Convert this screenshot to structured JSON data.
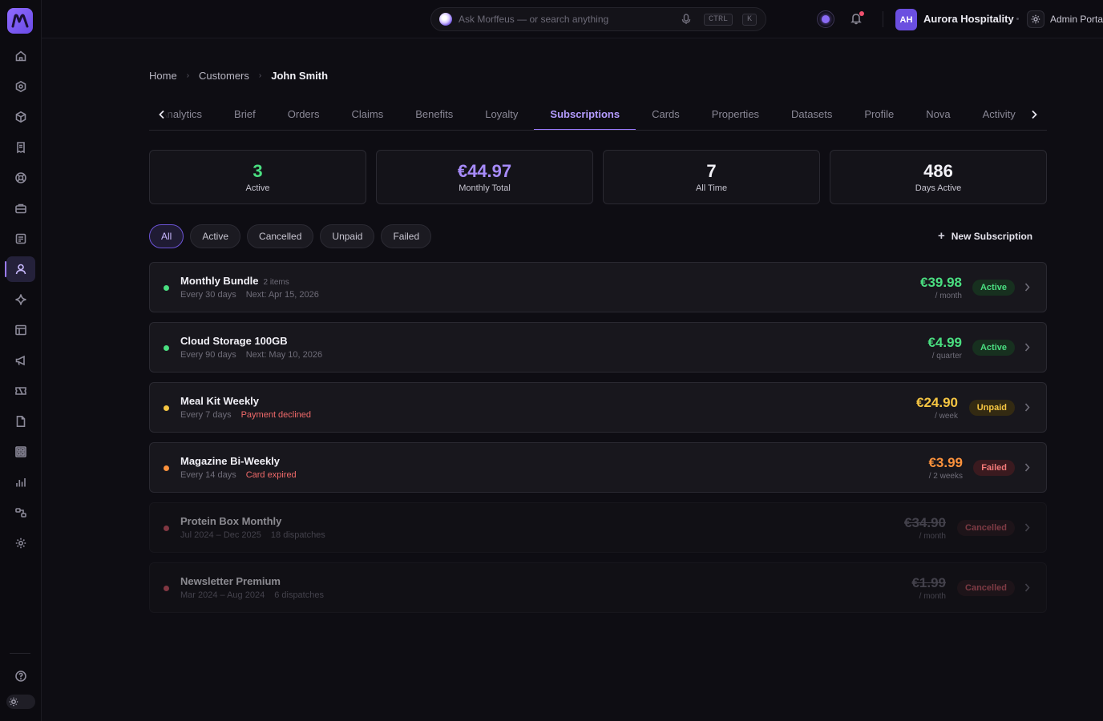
{
  "colors": {
    "accent": "#9b7bff",
    "success": "#4ade80",
    "warning": "#f5c542",
    "danger": "#f47a7a",
    "orange": "#fb923c"
  },
  "search": {
    "placeholder": "Ask Morffeus — or search anything",
    "shortcut_1": "CTRL",
    "shortcut_2": "K"
  },
  "account": {
    "initials": "AH",
    "org_name": "Aurora Hospitality",
    "portal_label": "Admin Portal"
  },
  "breadcrumb": {
    "home": "Home",
    "customers": "Customers",
    "current": "John Smith"
  },
  "tabs": [
    {
      "label": "Analytics"
    },
    {
      "label": "Brief"
    },
    {
      "label": "Orders"
    },
    {
      "label": "Claims"
    },
    {
      "label": "Benefits"
    },
    {
      "label": "Loyalty"
    },
    {
      "label": "Subscriptions"
    },
    {
      "label": "Cards"
    },
    {
      "label": "Properties"
    },
    {
      "label": "Datasets"
    },
    {
      "label": "Profile"
    },
    {
      "label": "Nova"
    },
    {
      "label": "Activity"
    }
  ],
  "stats": [
    {
      "value": "3",
      "label": "Active"
    },
    {
      "value": "€44.97",
      "label": "Monthly Total"
    },
    {
      "value": "7",
      "label": "All Time"
    },
    {
      "value": "486",
      "label": "Days Active"
    }
  ],
  "filters": [
    "All",
    "Active",
    "Cancelled",
    "Unpaid",
    "Failed"
  ],
  "new_subscription_label": "New Subscription",
  "subscriptions": [
    {
      "title": "Monthly Bundle",
      "count": "2 items",
      "meta1": "Every 30 days",
      "meta2": "Next: Apr 15, 2026",
      "price": "€39.98",
      "period": "/ month",
      "status": "Active"
    },
    {
      "title": "Cloud Storage 100GB",
      "count": "",
      "meta1": "Every 90 days",
      "meta2": "Next: May 10, 2026",
      "price": "€4.99",
      "period": "/ quarter",
      "status": "Active"
    },
    {
      "title": "Meal Kit Weekly",
      "count": "",
      "meta1": "Every 7 days",
      "meta2": "Payment declined",
      "price": "€24.90",
      "period": "/ week",
      "status": "Unpaid"
    },
    {
      "title": "Magazine Bi-Weekly",
      "count": "",
      "meta1": "Every 14 days",
      "meta2": "Card expired",
      "price": "€3.99",
      "period": "/ 2 weeks",
      "status": "Failed"
    },
    {
      "title": "Protein Box Monthly",
      "count": "",
      "meta1": "Jul 2024 – Dec 2025",
      "meta2": "18 dispatches",
      "price": "€34.90",
      "period": "/ month",
      "status": "Cancelled"
    },
    {
      "title": "Newsletter Premium",
      "count": "",
      "meta1": "Mar 2024 – Aug 2024",
      "meta2": "6 dispatches",
      "price": "€1.99",
      "period": "/ month",
      "status": "Cancelled"
    }
  ]
}
